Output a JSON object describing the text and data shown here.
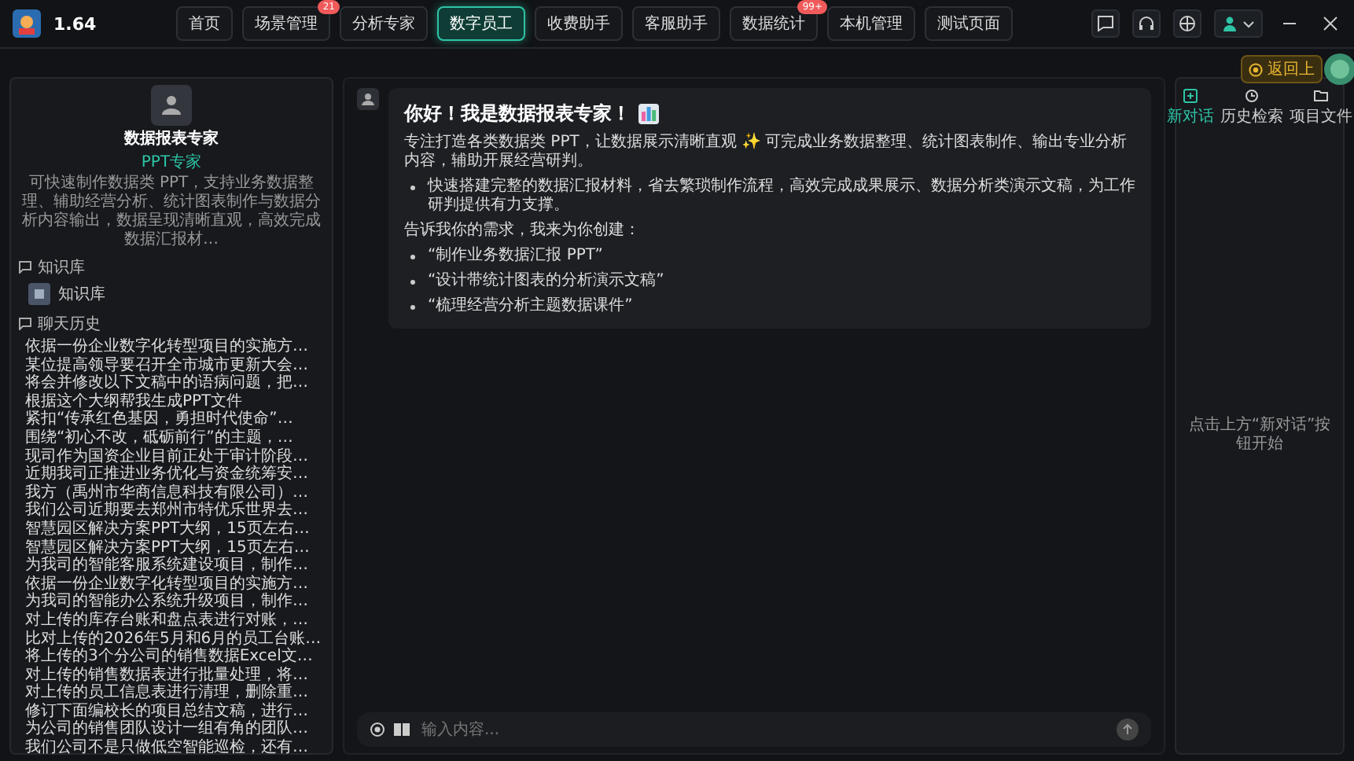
{
  "app": {
    "version": "1.64"
  },
  "nav": [
    {
      "label": "首页",
      "selected": false
    },
    {
      "label": "场景管理",
      "selected": false,
      "badge": "21"
    },
    {
      "label": "分析专家",
      "selected": false
    },
    {
      "label": "数字员工",
      "selected": true
    },
    {
      "label": "收费助手",
      "selected": false
    },
    {
      "label": "客服助手",
      "selected": false
    },
    {
      "label": "数据统计",
      "selected": false,
      "badge": "99+"
    },
    {
      "label": "本机管理",
      "selected": false
    },
    {
      "label": "测试页面",
      "selected": false
    }
  ],
  "return_button": {
    "label": "返回上"
  },
  "agent": {
    "name": "数据报表专家",
    "tag": "PPT专家",
    "description": "可快速制作数据类 PPT，支持业务数据整理、辅助经营分析、统计图表制作与数据分析内容输出，数据呈现清晰直观，高效完成数据汇报材…"
  },
  "knowledge": {
    "heading": "知识库",
    "items": [
      {
        "label": "知识库"
      }
    ]
  },
  "history": {
    "heading": "聊天历史",
    "items": [
      "依据一份企业数字化转型项目的实施方…",
      "某位提高领导要召开全市城市更新大会…",
      "将会并修改以下文稿中的语病问题，把…",
      "根据这个大纲帮我生成PPT文件",
      "紧扣“传承红色基因，勇担时代使命”…",
      "围绕“初心不改，砥砺前行”的主题，…",
      "现司作为国资企业目前正处于审计阶段…",
      "近期我司正推进业务优化与资金统筹安…",
      "我方（禹州市华商信息科技有限公司）…",
      "我们公司近期要去郑州市特优乐世界去…",
      "智慧园区解决方案PPT大纲，15页左右…",
      "智慧园区解决方案PPT大纲，15页左右…",
      "为我司的智能客服系统建设项目，制作…",
      "依据一份企业数字化转型项目的实施方…",
      "为我司的智能办公系统升级项目，制作…",
      "对上传的库存台账和盘点表进行对账，…",
      "比对上传的2026年5月和6月的员工台账…",
      "将上传的3个分公司的销售数据Excel文…",
      "对上传的销售数据表进行批量处理，将…",
      "对上传的员工信息表进行清理，删除重…",
      "修订下面编校长的项目总结文稿，进行…",
      "为公司的销售团队设计一组有角的团队…",
      "我们公司不是只做低空智能巡检，还有…"
    ]
  },
  "message": {
    "title": "你好！我是数据报表专家！",
    "blocks": [
      {
        "kind": "paragraph",
        "text": "专注打造各类数据类 PPT，让数据展示清晰直观 ✨ 可完成业务数据整理、统计图表制作、输出专业分析内容，辅助开展经营研判。"
      },
      {
        "kind": "bullet",
        "text": "快速搭建完整的数据汇报材料，省去繁琐制作流程，高效完成成果展示、数据分析类演示文稿，为工作研判提供有力支撑。"
      },
      {
        "kind": "paragraph",
        "text": "告诉我你的需求，我来为你创建："
      },
      {
        "kind": "bullet",
        "text": "“制作业务数据汇报 PPT”"
      },
      {
        "kind": "bullet",
        "text": "“设计带统计图表的分析演示文稿”"
      },
      {
        "kind": "bullet",
        "text": "“梳理经营分析主题数据课件”"
      }
    ]
  },
  "input": {
    "placeholder": "输入内容..."
  },
  "right_panel": {
    "tabs": [
      {
        "label": "新对话",
        "selected": true
      },
      {
        "label": "历史检索",
        "selected": false
      },
      {
        "label": "项目文件",
        "selected": false
      }
    ],
    "hint": "点击上方“新对话”按钮开始"
  }
}
